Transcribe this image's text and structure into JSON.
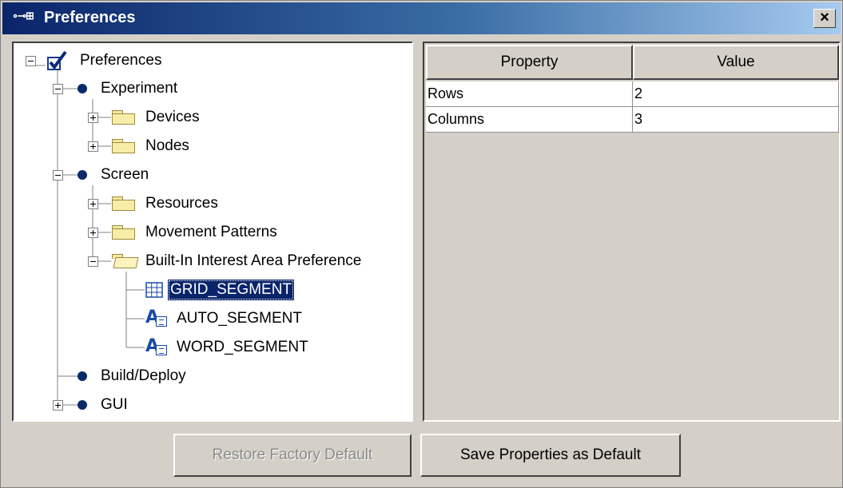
{
  "window": {
    "title": "Preferences",
    "title_icon": "∘⊸⊞",
    "close_label": "×"
  },
  "tree": {
    "root": "Preferences",
    "experiment": "Experiment",
    "devices": "Devices",
    "nodes": "Nodes",
    "screen": "Screen",
    "resources": "Resources",
    "movement_patterns": "Movement Patterns",
    "builtin_ia": "Built-In Interest Area Preference",
    "grid_segment": "GRID_SEGMENT",
    "auto_segment": "AUTO_SEGMENT",
    "word_segment": "WORD_SEGMENT",
    "build_deploy": "Build/Deploy",
    "gui": "GUI",
    "selected": "GRID_SEGMENT"
  },
  "table": {
    "headers": [
      "Property",
      "Value"
    ],
    "rows": [
      {
        "property": "Rows",
        "value": "2"
      },
      {
        "property": "Columns",
        "value": "3"
      }
    ]
  },
  "buttons": {
    "restore": "Restore Factory Default",
    "restore_enabled": false,
    "save": "Save Properties as Default"
  },
  "icons": {
    "title": "chain-link-icon",
    "root": "checkbox-checked-icon",
    "group": "bullet-icon",
    "folder": "folder-icon",
    "open_folder": "folder-open-icon",
    "grid": "grid-icon",
    "auto": "text-autosegment-icon",
    "word": "text-wordsegment-icon"
  },
  "colors": {
    "titlebar_start": "#0a246a",
    "titlebar_end": "#a6caf0",
    "selection": "#0a246a",
    "bullet": "#0a2a6a",
    "icon_blue": "#1a4aa8"
  }
}
